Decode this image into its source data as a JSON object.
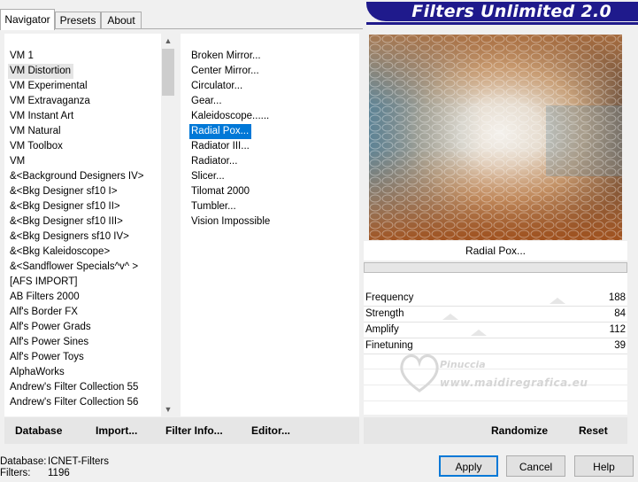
{
  "tabs": [
    {
      "label": "Navigator",
      "active": true
    },
    {
      "label": "Presets",
      "active": false
    },
    {
      "label": "About",
      "active": false
    }
  ],
  "title": "Filters Unlimited 2.0",
  "categories": [
    "VM 1",
    "VM Distortion",
    "VM Experimental",
    "VM Extravaganza",
    "VM Instant Art",
    "VM Natural",
    "VM Toolbox",
    "VM",
    "&<Background Designers IV>",
    "&<Bkg Designer sf10 I>",
    "&<Bkg Designer sf10 II>",
    "&<Bkg Designer sf10 III>",
    "&<Bkg Designers sf10 IV>",
    "&<Bkg Kaleidoscope>",
    "&<Sandflower Specials^v^ >",
    "[AFS IMPORT]",
    "AB Filters 2000",
    "Alf's Border FX",
    "Alf's Power Grads",
    "Alf's Power Sines",
    "Alf's Power Toys",
    "AlphaWorks",
    "Andrew's Filter Collection 55",
    "Andrew's Filter Collection 56"
  ],
  "selected_category": "VM Distortion",
  "filters": [
    "Broken Mirror...",
    "Center Mirror...",
    "Circulator...",
    "Gear...",
    "Kaleidoscope......",
    "Radial Pox...",
    "Radiator III...",
    "Radiator...",
    "Slicer...",
    "Tilomat 2000",
    "Tumbler...",
    "Vision Impossible"
  ],
  "selected_filter": "Radial Pox...",
  "preview_caption": "Radial Pox...",
  "params": [
    {
      "label": "Frequency",
      "value": "188"
    },
    {
      "label": "Strength",
      "value": "84"
    },
    {
      "label": "Amplify",
      "value": "112"
    },
    {
      "label": "Finetuning",
      "value": "39"
    }
  ],
  "watermark": {
    "line1": "Pinuccia",
    "line2": "www.maidiregrafica.eu"
  },
  "toolbar": {
    "database": "Database",
    "import": "Import...",
    "filter_info": "Filter Info...",
    "editor": "Editor...",
    "randomize": "Randomize",
    "reset": "Reset"
  },
  "status": {
    "database_label": "Database:",
    "database_value": "ICNET-Filters",
    "filters_label": "Filters:",
    "filters_value": "1196"
  },
  "buttons": {
    "apply": "Apply",
    "cancel": "Cancel",
    "help": "Help"
  },
  "icons": {
    "scroll_up": "chevron-up-icon",
    "scroll_down": "chevron-down-icon"
  },
  "colors": {
    "banner": "#1f1a8c",
    "highlight": "#0078d7",
    "selection": "#e5e5e5"
  }
}
